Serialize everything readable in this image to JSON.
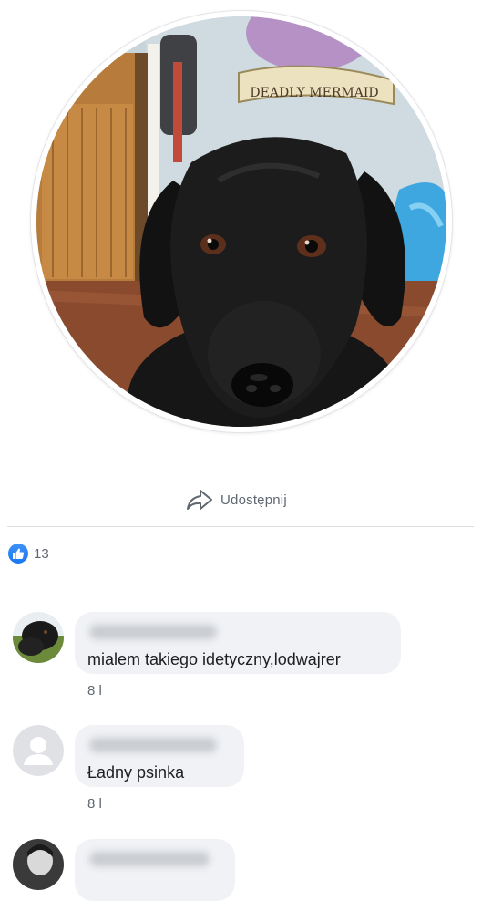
{
  "post": {
    "share_label": "Udostępnij",
    "like_count": "13",
    "photo_sign_text": "DEADLY MERMAID"
  },
  "comments": [
    {
      "text": "mialem takiego idetyczny,lodwajrer",
      "meta": "8 l"
    },
    {
      "text": "Ładny psinka",
      "meta": "8 l"
    },
    {
      "text": ""
    }
  ],
  "colors": {
    "like_blue": "#1877f2",
    "bubble_bg": "#f0f2f5",
    "meta_gray": "#606770"
  },
  "icons": [
    "share-arrow-icon",
    "thumbs-up-icon",
    "default-avatar-icon"
  ]
}
